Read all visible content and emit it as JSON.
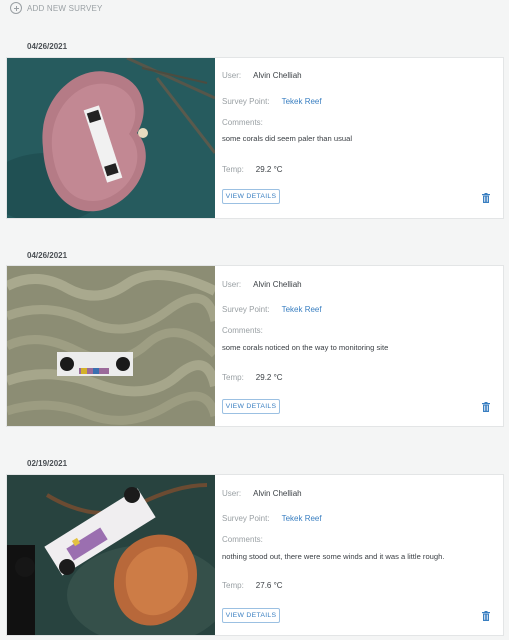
{
  "header": {
    "add_survey_label": "ADD NEW SURVEY",
    "add_icon": "plus-circle-icon"
  },
  "labels": {
    "user": "User:",
    "survey_point": "Survey Point:",
    "comments": "Comments:",
    "temp": "Temp:",
    "view_details": "VIEW DETAILS"
  },
  "colors": {
    "link": "#3a7fc1",
    "background": "#f4f5f5",
    "muted": "#9aa0a4"
  },
  "surveys": [
    {
      "date": "04/26/2021",
      "user": "Alvin Chelliah",
      "survey_point": "Tekek Reef",
      "comment": "some corals did seem paler than usual",
      "temp": "29.2 °C"
    },
    {
      "date": "04/26/2021",
      "user": "Alvin Chelliah",
      "survey_point": "Tekek Reef",
      "comment": "some corals noticed on the way to monitoring site",
      "temp": "29.2 °C"
    },
    {
      "date": "02/19/2021",
      "user": "Alvin Chelliah",
      "survey_point": "Tekek Reef",
      "comment": "nothing stood out, there were some winds and it was a little rough.",
      "temp": "27.6 °C"
    }
  ]
}
